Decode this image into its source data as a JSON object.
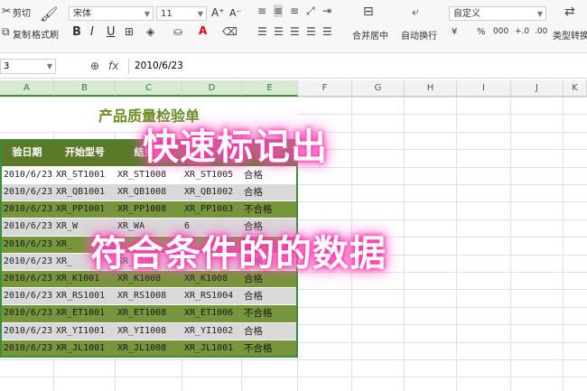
{
  "ribbon": {
    "cut": "剪切",
    "copy": "复制",
    "format_painter": "格式刷",
    "font_name": "宋体",
    "font_size": "11",
    "font_grow": "A⁺",
    "font_shrink": "A⁻",
    "bold": "B",
    "italic": "I",
    "underline": "U",
    "merge_center": "合并居中",
    "wrap_text": "自动换行",
    "number_format": "自定义",
    "currency": "¥",
    "percent": "%",
    "thousands": "000",
    "inc_decimal": "+.0",
    "dec_decimal": ".00",
    "type_convert": "类型转换"
  },
  "formula_bar": {
    "name_box": "3",
    "fx": "fx",
    "value": "2010/6/23"
  },
  "columns": [
    "A",
    "B",
    "C",
    "D",
    "E",
    "F",
    "G",
    "H",
    "I",
    "J",
    "K"
  ],
  "sheet": {
    "title": "产品质量检验单",
    "headers": [
      "验日期",
      "开始型号",
      "结束型",
      "",
      "",
      ""
    ],
    "rows": [
      [
        "2010/6/23",
        "XR_ST1001",
        "XR_ST1008",
        "XR_ST1005",
        "合格"
      ],
      [
        "2010/6/23",
        "XR_QB1001",
        "XR_QB1008",
        "XR_QB1002",
        "合格"
      ],
      [
        "2010/6/23",
        "XR_PP1001",
        "XR_PP1008",
        "XR_PP1003",
        "不合格"
      ],
      [
        "2010/6/23",
        "XR_W",
        "XR_WA",
        "6",
        "合格"
      ],
      [
        "2010/6/23",
        "XR_",
        "",
        "",
        "合格"
      ],
      [
        "2010/6/23",
        "XR_",
        "XR_K108",
        "",
        "合格"
      ],
      [
        "2010/6/23",
        "XR_K1001",
        "XR_K1008",
        "XR_K1008",
        "合格"
      ],
      [
        "2010/6/23",
        "XR_RS1001",
        "XR_RS1008",
        "XR_RS1004",
        "合格"
      ],
      [
        "2010/6/23",
        "XR_ET1001",
        "XR_ET1008",
        "XR_ET1006",
        "不合格"
      ],
      [
        "2010/6/23",
        "XR_YI1001",
        "XR_YI1008",
        "XR_YI1002",
        "合格"
      ],
      [
        "2010/6/23",
        "XR_JL1001",
        "XR_JL1008",
        "XR_JL1001",
        "不合格"
      ]
    ]
  },
  "overlay": {
    "line1": "快速标记出",
    "line2": "符合条件的的数据"
  },
  "colors": {
    "green": "#77953a",
    "grey": "#d9d9d9",
    "title_green": "#6b8e23",
    "header_green": "#5a7a2a",
    "glow": "#ff2da8"
  }
}
